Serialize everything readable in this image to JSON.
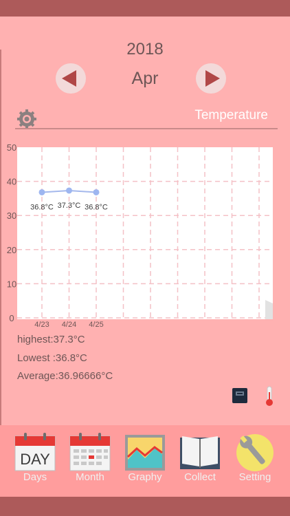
{
  "header": {
    "year": "2018",
    "month": "Apr"
  },
  "section": {
    "title": "Temperature",
    "settings_icon": "gear-icon"
  },
  "chart_data": {
    "type": "line",
    "y_ticks": [
      0,
      10,
      20,
      30,
      40,
      50
    ],
    "ylim": [
      0,
      50
    ],
    "grid": true,
    "categories": [
      "4/23",
      "4/24",
      "4/25"
    ],
    "values": [
      36.8,
      37.3,
      36.8
    ],
    "point_labels": [
      "36.8°C",
      "37.3°C",
      "36.8°C"
    ],
    "colors": {
      "line": "#a4b8ec",
      "point": "#9eb6f0",
      "grid": "#f4c0c6"
    }
  },
  "stats": {
    "highest": "highest:37.3°C",
    "lowest": "Lowest :36.8°C",
    "average": "Average:36.96666°C"
  },
  "tabs": [
    {
      "label": "Days",
      "icon": "calendar-day-icon"
    },
    {
      "label": "Month",
      "icon": "calendar-month-icon"
    },
    {
      "label": "Graphy",
      "icon": "graph-icon"
    },
    {
      "label": "Collect",
      "icon": "book-icon"
    },
    {
      "label": "Setting",
      "icon": "wrench-icon"
    }
  ],
  "calendar_day_text": "DAY",
  "colors": {
    "background": "#ffb1b1",
    "bar": "#ad5a5a",
    "tabbar": "#ff9d9d",
    "accent": "#b04747"
  }
}
